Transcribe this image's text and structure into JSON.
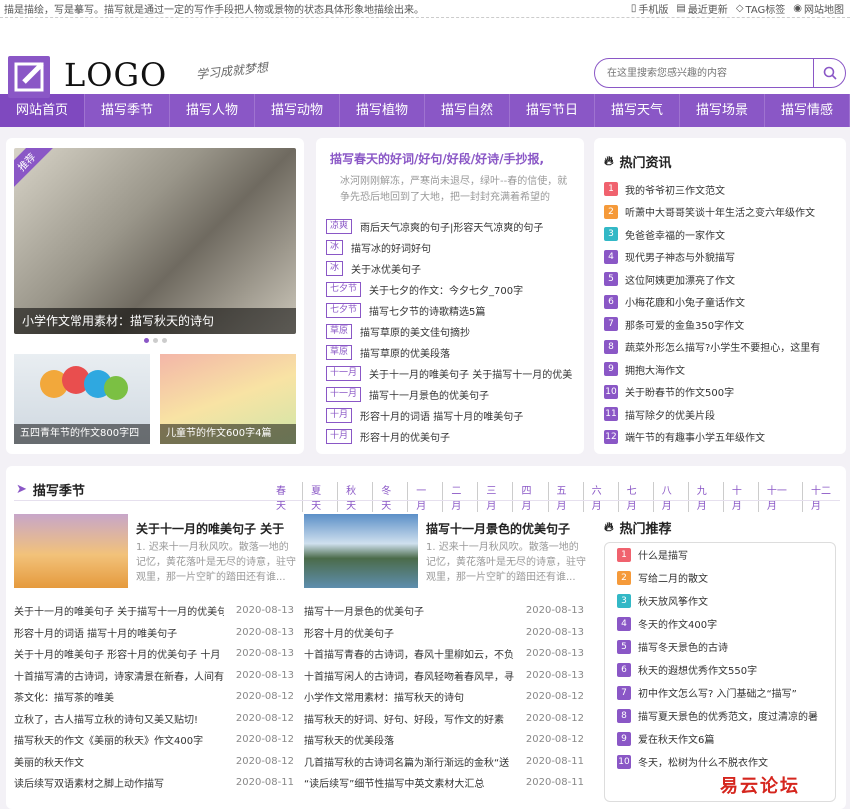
{
  "topbar": {
    "tagline": "描是描绘，写是摹写。描写就是通过一定的写作手段把人物或景物的状态具体形象地描绘出来。",
    "links": [
      "手机版",
      "最近更新",
      "TAG标签",
      "网站地图"
    ]
  },
  "header": {
    "logo": "LOGO",
    "slogan": "学习成就梦想",
    "search_placeholder": "在这里搜索您感兴趣的内容"
  },
  "nav": [
    "网站首页",
    "描写季节",
    "描写人物",
    "描写动物",
    "描写植物",
    "描写自然",
    "描写节日",
    "描写天气",
    "描写场景",
    "描写情感"
  ],
  "featured": {
    "badge": "推荐",
    "slide_caption": "小学作文常用素材：描写秋天的诗句",
    "thumb1": "五四青年节的作文800字四",
    "thumb2": "儿童节的作文600字4篇"
  },
  "middle": {
    "headline": "描写春天的好词/好句/好段/好诗/手抄报,",
    "desc": "冰河刚刚解冻，严寒尚未退尽，绿叶--春的信使，就争先恐后地回到了大地，把一封封充满着希望的",
    "items": [
      {
        "tag": "凉爽",
        "text": "雨后天气凉爽的句子|形容天气凉爽的句子"
      },
      {
        "tag": "冰",
        "text": "描写冰的好词好句"
      },
      {
        "tag": "冰",
        "text": "关于冰优美句子"
      },
      {
        "tag": "七夕节",
        "text": "关于七夕的作文：今夕七夕_700字"
      },
      {
        "tag": "七夕节",
        "text": "描写七夕节的诗歌精选5篇"
      },
      {
        "tag": "草原",
        "text": "描写草原的美文佳句摘抄"
      },
      {
        "tag": "草原",
        "text": "描写草原的优美段落"
      },
      {
        "tag": "十一月",
        "text": "关于十一月的唯美句子 关于描写十一月的优美"
      },
      {
        "tag": "十一月",
        "text": "描写十一月景色的优美句子"
      },
      {
        "tag": "十月",
        "text": "形容十月的词语 描写十月的唯美句子"
      },
      {
        "tag": "十月",
        "text": "形容十月的优美句子"
      }
    ]
  },
  "hot": {
    "title": "热门资讯",
    "items": [
      "我的爷爷初三作文范文",
      "听萧中大哥哥笑谈十年生活之变六年级作文",
      "免爸爸幸福的一家作文",
      "现代男子神态与外貌描写",
      "这位阿姨更加漂亮了作文",
      "小梅花鹿和小兔子童话作文",
      "那条可爱的金鱼350字作文",
      "蔬菜外形怎么描写?小学生不要担心，这里有",
      "拥抱大海作文",
      "关于盼春节的作文500字",
      "描写除夕的优美片段",
      "端午节的有趣事小学五年级作文"
    ]
  },
  "season": {
    "title": "描写季节",
    "links": [
      "春天",
      "夏天",
      "秋天",
      "冬天",
      "一月",
      "二月",
      "三月",
      "四月",
      "五月",
      "六月",
      "七月",
      "八月",
      "九月",
      "十月",
      "十一月",
      "十二月"
    ],
    "feat1": {
      "title": "关于十一月的唯美句子 关于",
      "desc": "1. 迟来十一月秋风吹。散落一地的记忆，黄花落叶是无尽的诗意，驻守观里，那一片空旷的踏田还有谁..."
    },
    "feat2": {
      "title": "描写十一月景色的优美句子",
      "desc": "1. 迟来十一月秋风吹。散落一地的记忆，黄花落叶是无尽的诗意，驻守观里，那一片空旷的踏田还有谁..."
    },
    "list1": [
      {
        "t": "关于十一月的唯美句子 关于描写十一月的优美句",
        "d": "2020-08-13"
      },
      {
        "t": "形容十月的词语 描写十月的唯美句子",
        "d": "2020-08-13"
      },
      {
        "t": "关于十月的唯美句子 形容十月的优美句子 十月",
        "d": "2020-08-13"
      },
      {
        "t": "十首描写清的古诗词，诗家清景在新春，人间有",
        "d": "2020-08-13"
      },
      {
        "t": "茶文化：描写茶的唯美",
        "d": "2020-08-12"
      },
      {
        "t": "立秋了，古人描写立秋的诗句又美又贴切!",
        "d": "2020-08-12"
      },
      {
        "t": "描写秋天的作文《美丽的秋天》作文400字",
        "d": "2020-08-12"
      },
      {
        "t": "美丽的秋天作文",
        "d": "2020-08-12"
      },
      {
        "t": "读后续写双语素材之脚上动作描写",
        "d": "2020-08-11"
      }
    ],
    "list2": [
      {
        "t": "描写十一月景色的优美句子",
        "d": "2020-08-13"
      },
      {
        "t": "形容十月的优美句子",
        "d": "2020-08-13"
      },
      {
        "t": "十首描写青春的古诗词，春风十里柳如云，不负",
        "d": "2020-08-13"
      },
      {
        "t": "十首描写闲人的古诗词，春风轻吻着春风早，寻春",
        "d": "2020-08-13"
      },
      {
        "t": "小学作文常用素材：描写秋天的诗句",
        "d": "2020-08-12"
      },
      {
        "t": "描写秋天的好词、好句、好段，写作文的好素",
        "d": "2020-08-12"
      },
      {
        "t": "描写秋天的优美段落",
        "d": "2020-08-12"
      },
      {
        "t": "几首描写秋的古诗词名篇为渐行渐远的金秋“送",
        "d": "2020-08-11"
      },
      {
        "t": "“读后续写”细节性描写中英文素材大汇总",
        "d": "2020-08-11"
      }
    ]
  },
  "recommend": {
    "title": "热门推荐",
    "items": [
      "什么是描写",
      "写给二月的散文",
      "秋天放风筝作文",
      "冬天的作文400字",
      "描写冬天景色的古诗",
      "秋天的遐想优秀作文550字",
      "初中作文怎么写? 入门基础之“描写”",
      "描写夏天景色的优秀范文，度过清凉的暑",
      "爱在秋天作文6篇",
      "冬天，松树为什么不脱衣作文"
    ]
  },
  "watermark": "易云论坛",
  "colors": {
    "accent": "#8a57c6",
    "num": [
      "#f0626e",
      "#f59a3a",
      "#33b8c6",
      "#8a57c6"
    ]
  }
}
